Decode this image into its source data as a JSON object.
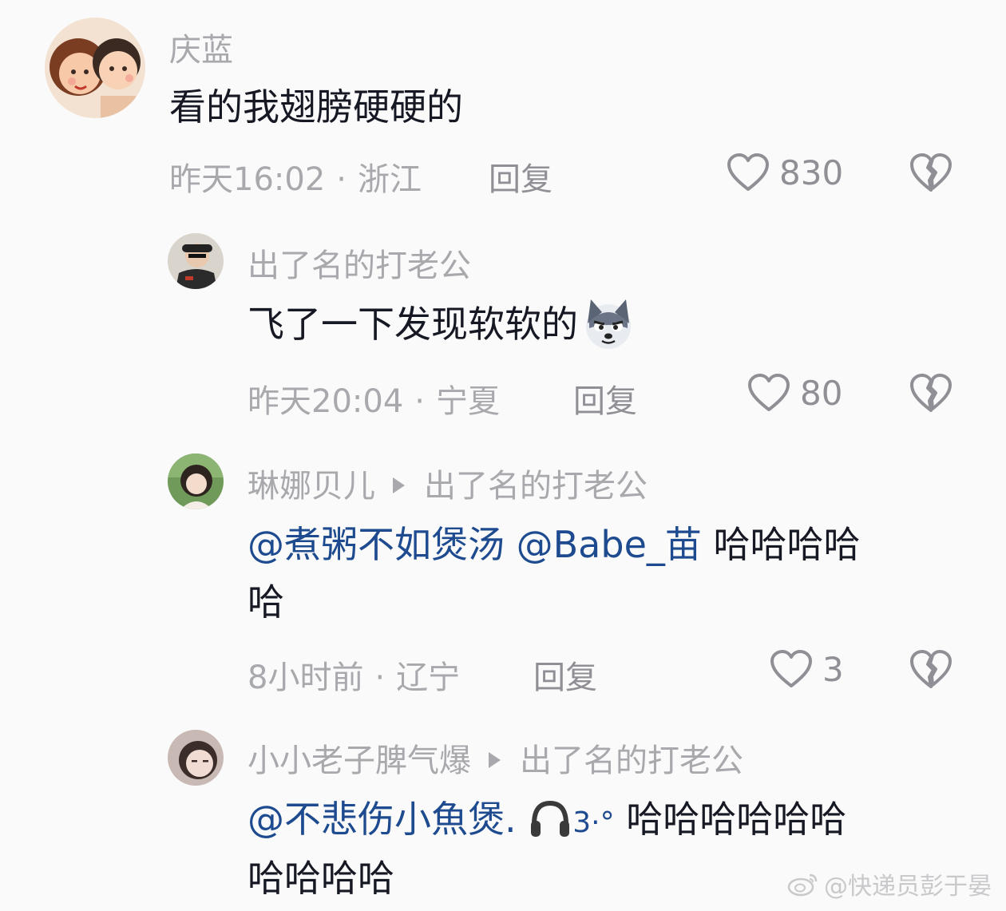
{
  "comments": [
    {
      "username": "庆蓝",
      "text": "看的我翅膀硬硬的",
      "time": "昨天16:02",
      "region": "浙江",
      "reply_label": "回复",
      "likes": "830"
    },
    {
      "username": "出了名的打老公",
      "text": "飞了一下发现软软的",
      "emoji": "wolf-emoji",
      "time": "昨天20:04",
      "region": "宁夏",
      "reply_label": "回复",
      "likes": "80"
    },
    {
      "username": "琳娜贝儿",
      "reply_to": "出了名的打老公",
      "mention_1": "@煮粥不如煲汤",
      "mention_2": "@Babe_苗",
      "text_line1": "哈哈哈哈",
      "text_line2": "哈",
      "time": "8小时前",
      "region": "辽宁",
      "reply_label": "回复",
      "likes": "3"
    },
    {
      "username": "小小老子脾气爆",
      "reply_to": "出了名的打老公",
      "mention_1": "@不悲伤小魚煲.",
      "mention_suffix": "3·°",
      "text_line1": "哈哈哈哈哈哈",
      "text_line2": "哈哈哈哈"
    }
  ],
  "watermark": "@快递员彭于晏",
  "colors": {
    "background": "#fafafa",
    "text": "#161823",
    "muted": "#a8a8ad",
    "mention": "#1e4b8f"
  }
}
